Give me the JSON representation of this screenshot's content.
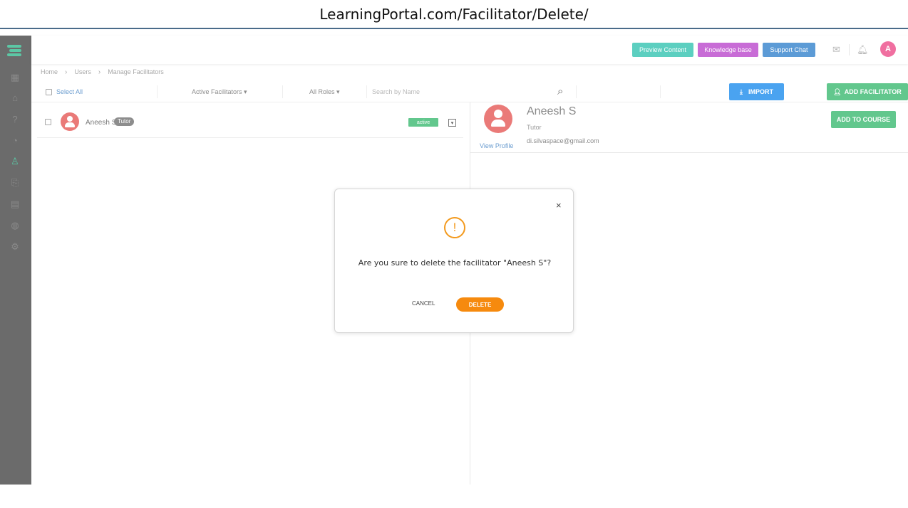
{
  "url": "LearningPortal.com/Facilitator/Delete/",
  "topbar": {
    "preview_label": "Preview Content",
    "kb_label": "Knowledge base",
    "support_label": "Support Chat",
    "avatar_initial": "A",
    "colors": {
      "preview": "#5ccfc0",
      "kb": "#c86cd6",
      "support": "#5c9bd6",
      "avatar": "#f06fa0"
    }
  },
  "breadcrumb": [
    "Home",
    "Users",
    "Manage Facilitators"
  ],
  "filters": {
    "select_all": "Select All",
    "facilitators": "Active Facilitators ▾",
    "roles": "All Roles ▾",
    "search_placeholder": "Search by Name",
    "import_label": "IMPORT",
    "add_facilitator_label": "ADD FACILITATOR"
  },
  "list": [
    {
      "name": "Aneesh S",
      "tag": "Tutor",
      "status": "active"
    }
  ],
  "detail": {
    "name": "Aneesh S",
    "role": "Tutor",
    "email": "di.silvaspace@gmail.com",
    "view_profile": "View Profile",
    "add_to_course": "ADD TO COURSE"
  },
  "modal": {
    "close": "×",
    "warning_glyph": "!",
    "message": "Are you sure to delete the facilitator \"Aneesh S\"?",
    "cancel_label": "CANCEL",
    "delete_label": "DELETE",
    "accent": "#f68a0e"
  },
  "sidebar": {
    "icons": [
      "dashboard-icon",
      "courses-icon",
      "help-icon",
      "reports-icon",
      "users-icon",
      "content-icon",
      "clipboard-icon",
      "globe-icon",
      "settings-icon"
    ],
    "active": "users-icon"
  }
}
